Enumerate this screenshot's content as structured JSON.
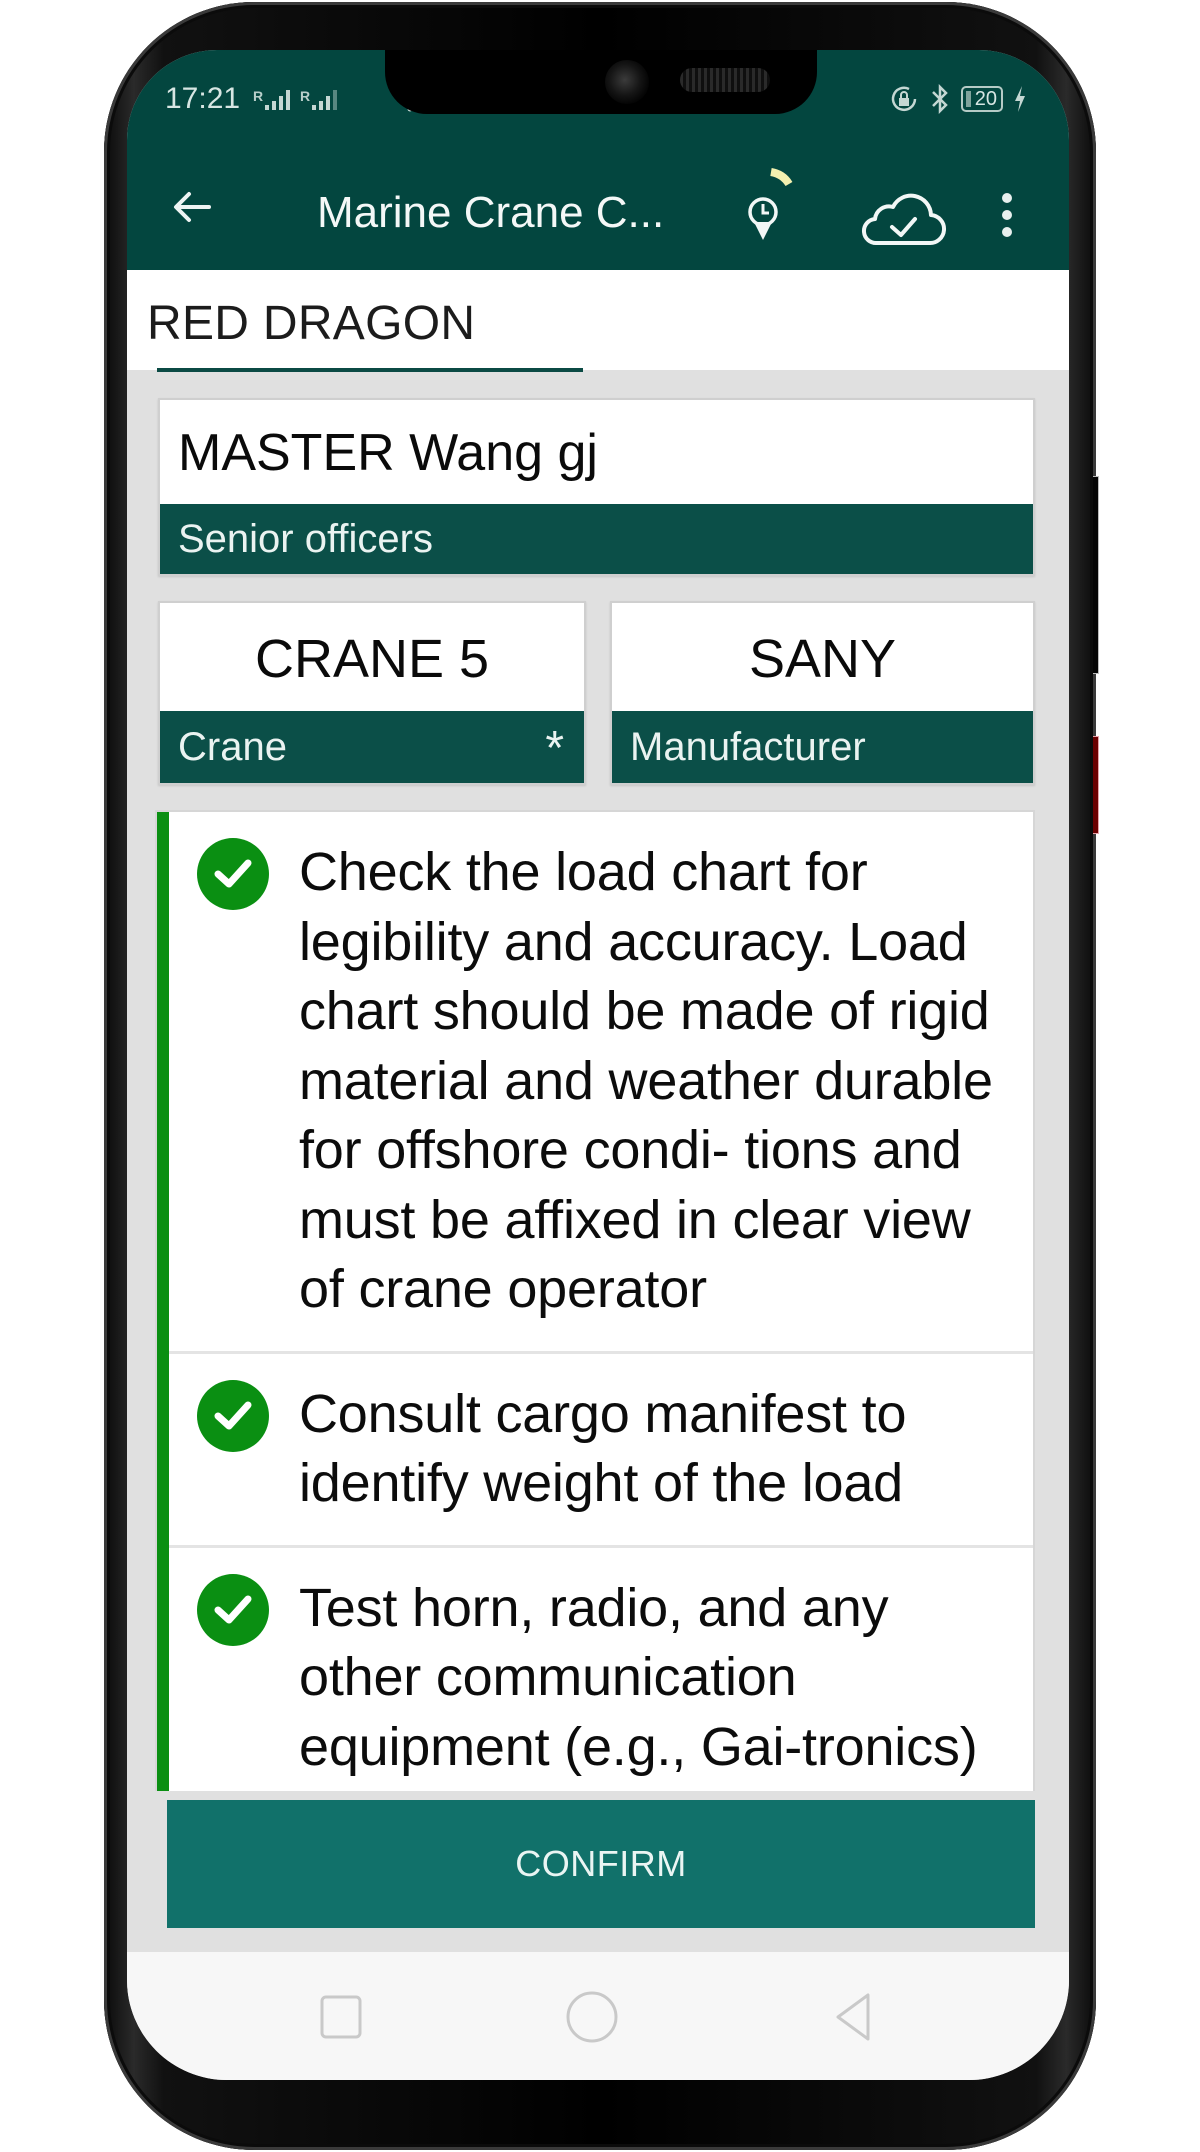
{
  "status_bar": {
    "time": "17:21",
    "sim1_label": "R",
    "sim2_label": "R",
    "battery_level": "20",
    "icons": [
      "signal-icon",
      "signal-icon",
      "wifi-icon",
      "rotation-lock-icon",
      "bluetooth-icon",
      "battery-icon",
      "charging-icon"
    ]
  },
  "toolbar": {
    "title": "Marine Crane C...",
    "back_icon": "arrow-left-icon",
    "geo_icon": "location-clock-icon",
    "sync_icon": "cloud-check-icon",
    "menu_icon": "more-vertical-icon"
  },
  "header": {
    "vessel_name": "RED DRAGON"
  },
  "fields": {
    "person": {
      "value": "MASTER Wang gj",
      "label": "Senior officers"
    },
    "crane": {
      "value": "CRANE 5",
      "label": "Crane",
      "required_mark": "*"
    },
    "manufacturer": {
      "value": "SANY",
      "label": "Manufacturer"
    }
  },
  "checklist": {
    "items": [
      {
        "text": "Check the load chart for legibility and accuracy. Load chart should be made of rigid material and weather durable for offshore condi- tions and must be affixed in clear view of crane operator",
        "checked": true
      },
      {
        "text": "Consult cargo manifest to identify weight of the load",
        "checked": true
      },
      {
        "text": "Test horn, radio, and any other communication equipment (e.g., Gai-tronics) for proper operation",
        "checked": true
      }
    ]
  },
  "actions": {
    "confirm_label": "CONFIRM"
  },
  "navigation_bar": {
    "recent_icon": "square-icon",
    "home_icon": "circle-icon",
    "back_icon": "triangle-back-icon"
  },
  "colors": {
    "appbar": "#03463f",
    "label_band": "#0b4f48",
    "confirm_button": "#11716a",
    "check_green": "#0a8f12",
    "sync_arc": "#f3f0b0"
  }
}
